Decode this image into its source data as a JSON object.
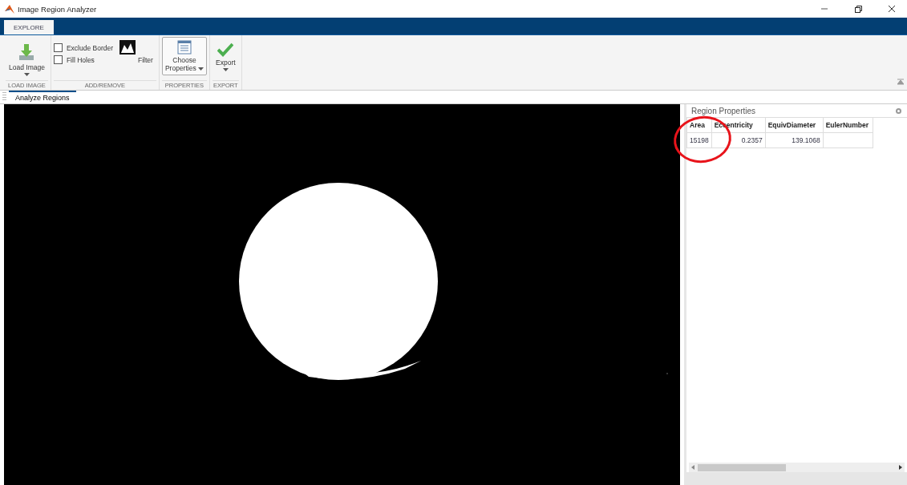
{
  "window": {
    "title": "Image Region Analyzer"
  },
  "tabs": [
    {
      "label": "EXPLORE",
      "selected": true
    }
  ],
  "toolstrip": {
    "sections": [
      {
        "label": "LOAD IMAGE",
        "items": [
          {
            "kind": "button",
            "label": "Load Image",
            "dropdown": true
          }
        ]
      },
      {
        "label": "ADD/REMOVE",
        "items": [
          {
            "kind": "checkbox",
            "label": "Exclude Border",
            "checked": false
          },
          {
            "kind": "checkbox",
            "label": "Fill Holes",
            "checked": false
          },
          {
            "kind": "button",
            "label": "Filter",
            "dropdown": false
          }
        ]
      },
      {
        "label": "PROPERTIES",
        "items": [
          {
            "kind": "button",
            "label": "Choose Properties",
            "dropdown": true,
            "framed": true
          }
        ]
      },
      {
        "label": "EXPORT",
        "items": [
          {
            "kind": "button",
            "label": "Export",
            "dropdown": true
          }
        ]
      }
    ]
  },
  "document_tabs": [
    {
      "label": "Analyze Regions",
      "selected": true
    }
  ],
  "properties_panel": {
    "title": "Region Properties",
    "table": {
      "columns": [
        "Area",
        "Eccentricity",
        "EquivDiameter",
        "EulerNumber"
      ],
      "rows": [
        [
          "15198",
          "0.2357",
          "139.1068",
          ""
        ]
      ]
    }
  },
  "annotation": {
    "kind": "circle",
    "color": "#e8141b"
  }
}
